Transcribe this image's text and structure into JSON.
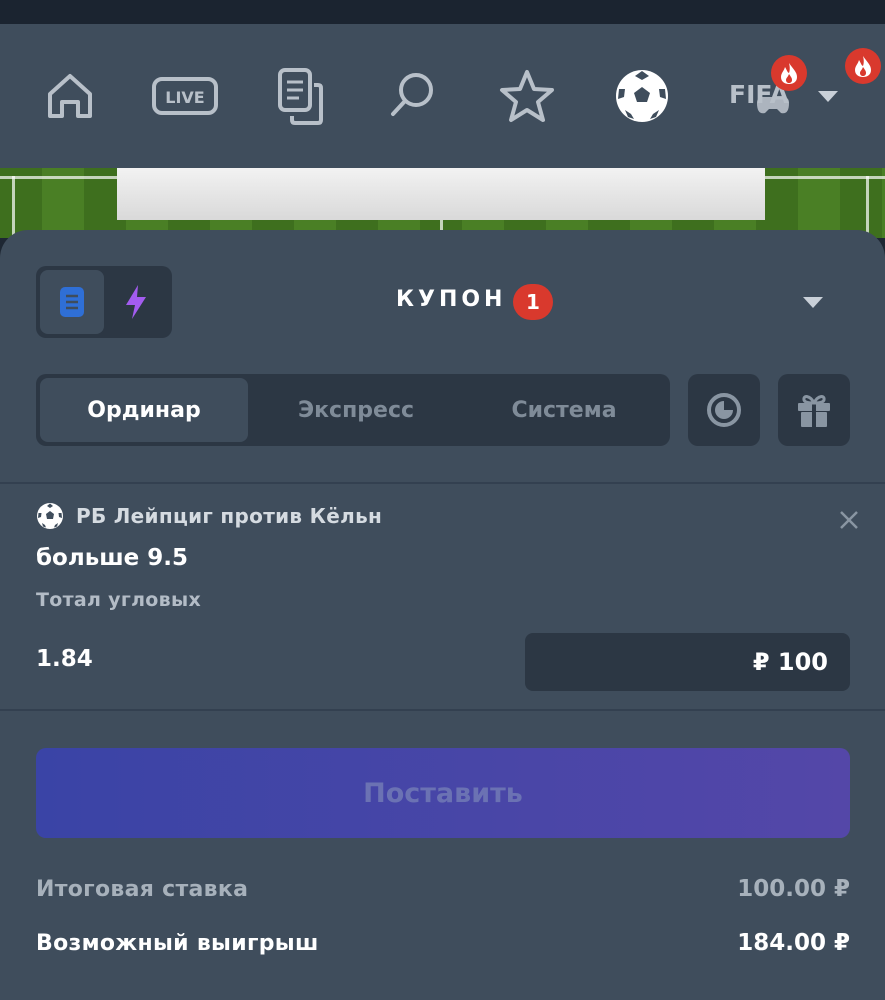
{
  "nav": {
    "items": [
      {
        "icon": "home-icon"
      },
      {
        "icon": "live-icon",
        "label": "LIVE"
      },
      {
        "icon": "bet-slip-icon"
      },
      {
        "icon": "search-icon"
      },
      {
        "icon": "star-icon"
      },
      {
        "icon": "soccer-ball-icon"
      },
      {
        "icon": "fifa-icon",
        "label": "FIFA"
      }
    ],
    "hot_badge_icon": "fire-icon"
  },
  "coupon": {
    "title": "КУПОН",
    "count": "1",
    "mode_icons": [
      "document-icon",
      "lightning-icon"
    ]
  },
  "tabs": [
    "Ординар",
    "Экспресс",
    "Система"
  ],
  "tools": [
    "clock-icon",
    "gift-icon"
  ],
  "bet": {
    "match": "РБ Лейпциг против Кёльн",
    "selection": "больше 9.5",
    "market": "Тотал угловых",
    "odds": "1.84",
    "stake": "₽ 100"
  },
  "place_button": "Поставить",
  "summary": {
    "total_label": "Итоговая ставка",
    "total_value": "100.00 ₽",
    "win_label": "Возможный выигрыш",
    "win_value": "184.00 ₽"
  },
  "colors": {
    "panel": "#3f4d5c",
    "inset": "#2c3744",
    "badge": "#d9392d",
    "accent_icon": "#2f6fd6",
    "bolt": "#a35cf0",
    "button_start": "#3a44a6",
    "button_end": "#5447a8"
  }
}
